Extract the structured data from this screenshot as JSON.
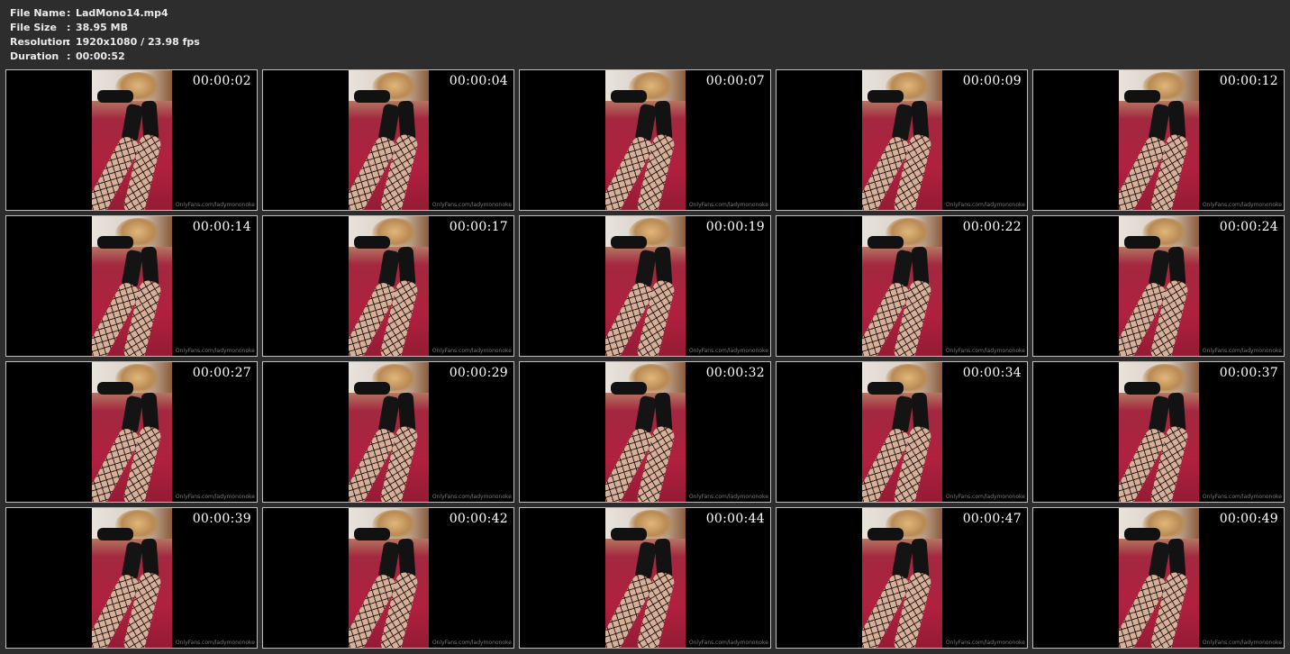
{
  "header": {
    "file_name": {
      "label": "File Name",
      "value": "LadMono14.mp4"
    },
    "file_size": {
      "label": "File Size",
      "value": "38.95 MB"
    },
    "resolution": {
      "label": "Resolution",
      "value": "1920x1080 / 23.98 fps"
    },
    "duration": {
      "label": "Duration",
      "value": "00:00:52"
    },
    "separator": ":"
  },
  "watermark": "OnlyFans.com/ladymononoke",
  "thumbnails": [
    "00:00:02",
    "00:00:04",
    "00:00:07",
    "00:00:09",
    "00:00:12",
    "00:00:14",
    "00:00:17",
    "00:00:19",
    "00:00:22",
    "00:00:24",
    "00:00:27",
    "00:00:29",
    "00:00:32",
    "00:00:34",
    "00:00:37",
    "00:00:39",
    "00:00:42",
    "00:00:44",
    "00:00:47",
    "00:00:49"
  ],
  "colors": {
    "background": "#2d2d2d",
    "header_text": "#eaeaea",
    "thumb_border": "#bdbdbd",
    "timestamp": "#ffffff"
  }
}
